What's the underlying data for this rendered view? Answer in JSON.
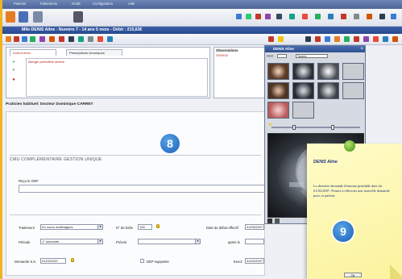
{
  "menu": [
    "Patients",
    "Traitements",
    "Outils",
    "Configuration",
    "Aide"
  ],
  "patient_bar": "Mlle DENIS Aline - Numéro 7 - 14 ans 5 mois - Débit : 215,63€",
  "tabs": [
    "Antécédents",
    "Prescriptions chroniques"
  ],
  "alert_line": "Allergie pénicilline sévère",
  "observations": {
    "title": "Observations",
    "line": "Anxieux"
  },
  "physician": "Praticien habituel: Docteur Dominique CARRET",
  "section_title": "CMU COMPLÉMENTAIRE GESTION UNIQUE",
  "recu_label": "Reçu le ODF",
  "fields": {
    "traitement_label": "Traitement",
    "traitement_value": "En cours multibagues",
    "nboite_label": "N° de boîte",
    "nboite_value": "105",
    "date_debut_label": "Date de début effectif",
    "date_debut_value": "01/09/2007",
    "periode_label": "Période",
    "periode_value": "1° semestre",
    "prevoir_label": "Prévoir",
    "prevoir_value": "",
    "apres_label": "après le",
    "apres_value": "",
    "demande_label": "Demande S.S.",
    "demande_value": "01/02/2007",
    "dep_label": "DEP supposée",
    "envoi_label": "Envoi",
    "envoi_value": "01/02/2007"
  },
  "imaging": {
    "title": "DENIS Aline",
    "dent_label": "Dent",
    "view_label": "Toutes"
  },
  "badges": {
    "left": "8",
    "right": "9"
  },
  "note": {
    "title": "DENIS Aline",
    "body": "La dernière demande d'entente préalable date du 01/02/2007. Pensez à effectuer une nouvelle demande pour ce patient.",
    "ok": "Ok"
  },
  "colors": {
    "background": "#f0b41e",
    "titlebar": "#2f4f90",
    "note": "#fbf39e",
    "badge": "#1a5fb8"
  }
}
